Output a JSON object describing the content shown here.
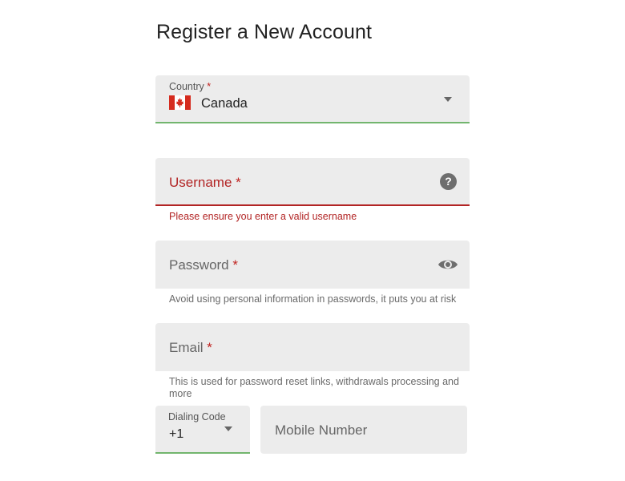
{
  "page": {
    "title": "Register a New Account"
  },
  "form": {
    "country": {
      "label": "Country",
      "required_mark": "*",
      "value": "Canada",
      "flag_icon": "canada-flag-icon"
    },
    "username": {
      "label": "Username",
      "required_mark": "*",
      "error": "Please ensure you enter a valid username",
      "help_icon": "question-mark-icon"
    },
    "password": {
      "label": "Password",
      "required_mark": "*",
      "hint": "Avoid using personal information in passwords, it puts you at risk",
      "toggle_icon": "eye-icon"
    },
    "email": {
      "label": "Email",
      "required_mark": "*",
      "hint": "This is used for password reset links, withdrawals processing and more"
    },
    "dialing_code": {
      "label": "Dialing Code",
      "value": "+1"
    },
    "mobile": {
      "label": "Mobile Number"
    }
  },
  "colors": {
    "error": "#b22424",
    "valid_underline": "#72b56e",
    "field_background": "#ececec"
  }
}
